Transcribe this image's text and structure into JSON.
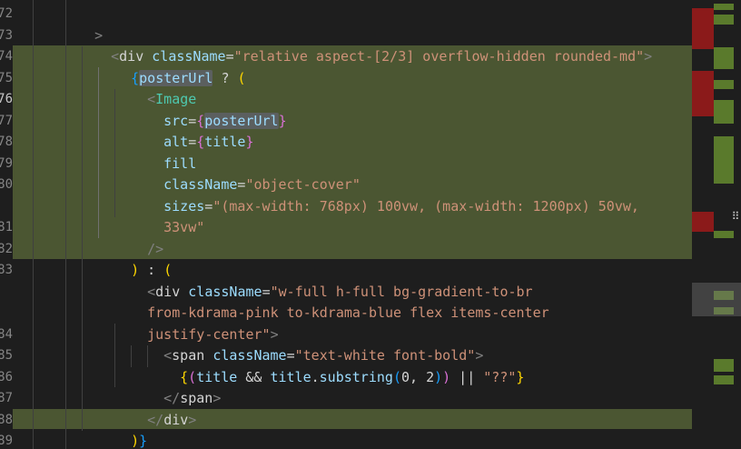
{
  "line_numbers": [
    "72",
    "73",
    "74",
    "75",
    "76",
    "77",
    "78",
    "79",
    "80",
    "",
    "81",
    "82",
    "83",
    "",
    "",
    "84",
    "85",
    "86",
    "87",
    "88",
    "89"
  ],
  "active_line": "76",
  "code": {
    "l72": {
      "close": ">"
    },
    "l73": {
      "open": "<",
      "tag": "div",
      "attr": "className",
      "eq": "=",
      "val": "\"relative aspect-[2/3] overflow-hidden rounded-md\"",
      "close": ">"
    },
    "l74": {
      "brace": "{",
      "ident": "posterUrl",
      "op": " ? ",
      "paren": "("
    },
    "l75": {
      "open": "<",
      "tag": "Image"
    },
    "l76": {
      "attr": "src",
      "eq": "=",
      "brace_open": "{",
      "ident": "posterUrl",
      "brace_close": "}"
    },
    "l77": {
      "attr": "alt",
      "eq": "=",
      "brace_open": "{",
      "ident": "title",
      "brace_close": "}"
    },
    "l78": {
      "attr": "fill"
    },
    "l79": {
      "attr": "className",
      "eq": "=",
      "val": "\"object-cover\""
    },
    "l80": {
      "attr": "sizes",
      "eq": "=",
      "val": "\"(max-width: 768px) 100vw, (max-width: 1200px) 50vw,"
    },
    "l80b": {
      "val": "33vw\""
    },
    "l81": {
      "close": "/>"
    },
    "l82": {
      "paren_close": ")",
      "op": " : ",
      "paren_open": "("
    },
    "l83": {
      "open": "<",
      "tag": "div",
      "attr": "className",
      "eq": "=",
      "val": "\"w-full h-full bg-gradient-to-br"
    },
    "l83b": {
      "val": "from-kdrama-pink to-kdrama-blue flex items-center"
    },
    "l83c": {
      "val": "justify-center\"",
      "close": ">"
    },
    "l84": {
      "open": "<",
      "tag": "span",
      "attr": "className",
      "eq": "=",
      "val": "\"text-white font-bold\"",
      "close": ">"
    },
    "l85": {
      "brace_open": "{",
      "paren_open": "(",
      "ident1": "title",
      "op1": " && ",
      "ident2": "title",
      "dot": ".",
      "method": "substring",
      "call_open": "(",
      "num1": "0",
      "comma": ", ",
      "num2": "2",
      "call_close": ")",
      "paren_close": ")",
      "op2": " || ",
      "str": "\"??\"",
      "brace_close": "}"
    },
    "l86": {
      "open": "</",
      "tag": "span",
      "close": ">"
    },
    "l87": {
      "open": "</",
      "tag": "div",
      "close": ">"
    },
    "l88": {
      "paren": ")",
      "brace": "}"
    },
    "l89": {
      "open": "</",
      "tag": "div",
      "close": ">"
    }
  },
  "minimap_icon": "grip-icon",
  "grip_glyph": "⠿",
  "colors": {
    "background": "#1e1e1e",
    "highlight": "#4b5632",
    "minimap_green": "#5a7a2c",
    "minimap_red": "#8b1a1a"
  }
}
